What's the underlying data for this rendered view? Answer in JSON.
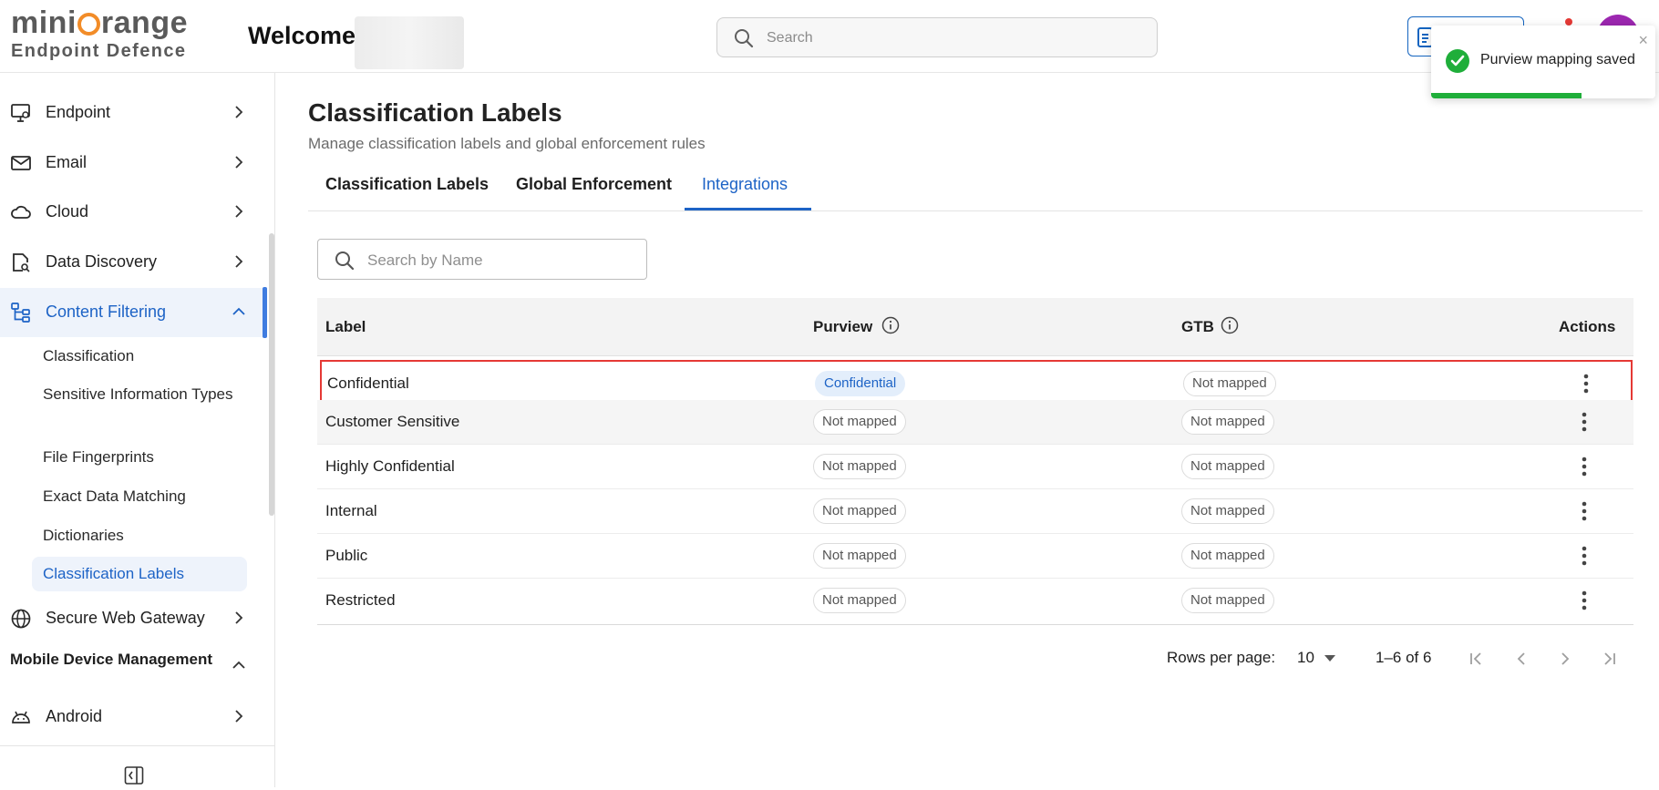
{
  "brand": {
    "logo_text_left": "mini",
    "logo_text_right": "range",
    "logo_sub": "Endpoint Defence"
  },
  "header": {
    "welcome": "Welcome,",
    "search_placeholder": "Search"
  },
  "toast": {
    "message": "Purview mapping saved",
    "close": "×",
    "progress": 0.67
  },
  "sidebar": {
    "items": [
      {
        "label": "Endpoint",
        "icon": "monitor-gear-icon"
      },
      {
        "label": "Email",
        "icon": "mail-icon"
      },
      {
        "label": "Cloud",
        "icon": "cloud-icon"
      },
      {
        "label": "Data Discovery",
        "icon": "file-search-icon"
      },
      {
        "label": "Content Filtering",
        "icon": "tree-icon",
        "expanded": true,
        "active": true
      }
    ],
    "sub_items": [
      "Classification",
      "Sensitive Information Types",
      "File Fingerprints",
      "Exact Data Matching",
      "Dictionaries",
      "Classification Labels"
    ],
    "active_sub": "Classification Labels",
    "secure_web_gateway": {
      "label": "Secure Web Gateway",
      "icon": "globe-icon"
    },
    "section_title": "Mobile Device Management",
    "android": {
      "label": "Android",
      "icon": "android-icon"
    }
  },
  "page": {
    "title": "Classification Labels",
    "subtitle": "Manage classification labels and global enforcement rules",
    "tabs": [
      "Classification Labels",
      "Global Enforcement",
      "Integrations"
    ],
    "active_tab": "Integrations",
    "name_search_placeholder": "Search by Name"
  },
  "table": {
    "columns": [
      "Label",
      "Purview",
      "GTB",
      "Actions"
    ],
    "rows": [
      {
        "label": "Confidential",
        "purview": "Confidential",
        "purview_mapped": true,
        "gtb": "Not mapped"
      },
      {
        "label": "Customer Sensitive",
        "purview": "Not mapped",
        "purview_mapped": false,
        "gtb": "Not mapped"
      },
      {
        "label": "Highly Confidential",
        "purview": "Not mapped",
        "purview_mapped": false,
        "gtb": "Not mapped"
      },
      {
        "label": "Internal",
        "purview": "Not mapped",
        "purview_mapped": false,
        "gtb": "Not mapped"
      },
      {
        "label": "Public",
        "purview": "Not mapped",
        "purview_mapped": false,
        "gtb": "Not mapped"
      },
      {
        "label": "Restricted",
        "purview": "Not mapped",
        "purview_mapped": false,
        "gtb": "Not mapped"
      }
    ]
  },
  "pagination": {
    "rows_per_page_label": "Rows per page:",
    "rows_per_page": "10",
    "range": "1–6 of 6"
  },
  "colors": {
    "accent": "#1d63c6",
    "success": "#1fae3a",
    "highlight_border": "#e53935",
    "brand_orange": "#f28c28"
  }
}
